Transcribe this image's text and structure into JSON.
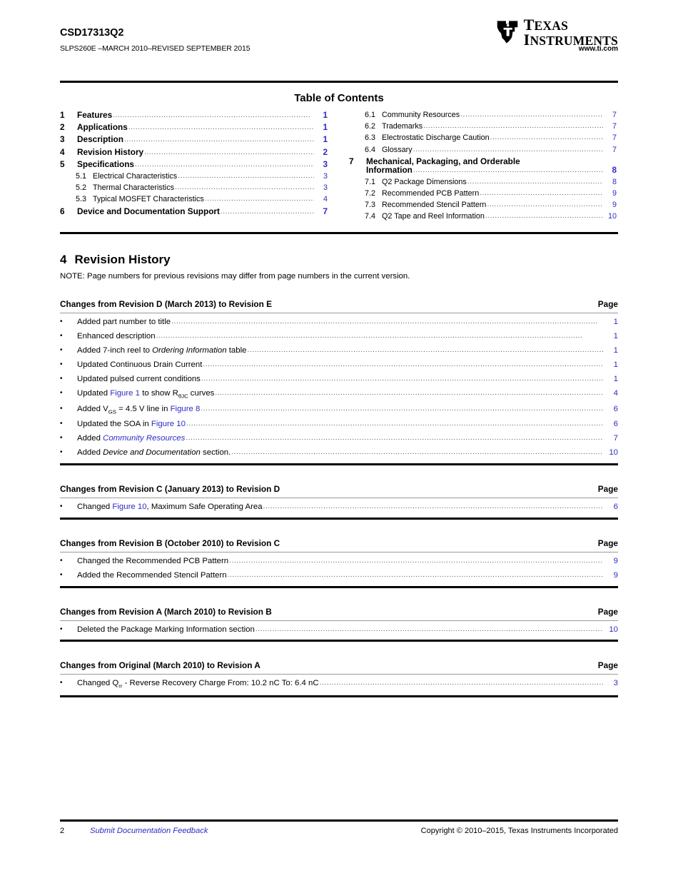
{
  "header": {
    "part_number": "CSD17313Q2",
    "doc_id": "SLPS260E –MARCH 2010–REVISED SEPTEMBER 2015",
    "url": "www.ti.com",
    "logo_line1": "EXAS",
    "logo_line1_cap": "T",
    "logo_line2": "NSTRUMENTS",
    "logo_line2_cap": "I",
    "logo_mark": "ti-texas-logo"
  },
  "toc": {
    "title": "Table of Contents",
    "left_column": [
      {
        "num": "1",
        "label": "Features",
        "page": "1",
        "level": 1
      },
      {
        "num": "2",
        "label": "Applications",
        "page": "1",
        "level": 1
      },
      {
        "num": "3",
        "label": "Description",
        "page": "1",
        "level": 1
      },
      {
        "num": "4",
        "label": "Revision History",
        "page": "2",
        "level": 1
      },
      {
        "num": "5",
        "label": "Specifications",
        "page": "3",
        "level": 1
      },
      {
        "num": "5.1",
        "label": "Electrical Characteristics",
        "page": "3",
        "level": 2
      },
      {
        "num": "5.2",
        "label": "Thermal Characteristics",
        "page": "3",
        "level": 2
      },
      {
        "num": "5.3",
        "label": "Typical MOSFET Characteristics",
        "page": "4",
        "level": 2
      },
      {
        "num": "6",
        "label": "Device and Documentation Support",
        "page": "7",
        "level": 1
      }
    ],
    "right_column": [
      {
        "num": "6.1",
        "label": "Community Resources",
        "page": "7",
        "level": 2
      },
      {
        "num": "6.2",
        "label": "Trademarks",
        "page": "7",
        "level": 2
      },
      {
        "num": "6.3",
        "label": "Electrostatic Discharge Caution",
        "page": "7",
        "level": 2
      },
      {
        "num": "6.4",
        "label": "Glossary",
        "page": "7",
        "level": 2
      },
      {
        "num": "7",
        "label": "Mechanical, Packaging, and Orderable",
        "label2": "Information",
        "page": "8",
        "level": 1,
        "wrap": true
      },
      {
        "num": "7.1",
        "label": "Q2 Package Dimensions",
        "page": "8",
        "level": 2
      },
      {
        "num": "7.2",
        "label": "Recommended PCB Pattern",
        "page": "9",
        "level": 2
      },
      {
        "num": "7.3",
        "label": "Recommended Stencil Pattern",
        "page": "9",
        "level": 2
      },
      {
        "num": "7.4",
        "label": "Q2 Tape and Reel Information",
        "page": "10",
        "level": 2
      }
    ]
  },
  "revision_history": {
    "section_num": "4",
    "section_title": "Revision History",
    "note": "NOTE: Page numbers for previous revisions may differ from page numbers in the current version.",
    "page_col_label": "Page",
    "bullet": "•",
    "blocks": [
      {
        "heading": "Changes from Revision D (March 2013) to Revision E",
        "page_label": "Page",
        "changes": [
          {
            "page": "1"
          },
          {
            "page": "1"
          },
          {
            "page": "1"
          },
          {
            "page": "1"
          },
          {
            "page": "1"
          },
          {
            "page": "4"
          },
          {
            "page": "6"
          },
          {
            "page": "6"
          },
          {
            "page": "7"
          },
          {
            "page": "10"
          }
        ]
      },
      {
        "heading": "Changes from Revision C (January 2013) to Revision D",
        "page_label": "Page",
        "changes": [
          {
            "page": "6"
          }
        ]
      },
      {
        "heading": "Changes from Revision B (October 2010) to Revision C",
        "page_label": "Page",
        "changes": [
          {
            "page": "9"
          },
          {
            "page": "9"
          }
        ]
      },
      {
        "heading": "Changes from Revision A (March 2010) to Revision B",
        "page_label": "Page",
        "changes": [
          {
            "page": "10"
          }
        ]
      },
      {
        "heading": "Changes from Original (March 2010) to Revision A",
        "page_label": "Page",
        "changes": [
          {
            "page": "3"
          }
        ]
      }
    ],
    "text": {
      "d_1": "Added part number to title",
      "d_2": "Enhanced description",
      "d_3a": "Added 7-inch reel to ",
      "d_3b": "Ordering Information",
      "d_3c": " table",
      "d_4": "Updated Continuous Drain Current",
      "d_5": "Updated pulsed current conditions",
      "d_6a": "Updated ",
      "d_6b": "Figure 1",
      "d_6c": " to show R",
      "d_6sub": "θJC",
      "d_6d": " curves",
      "d_7a": "Added V",
      "d_7sub": "GS",
      "d_7b": " = 4.5 V line in ",
      "d_7c": "Figure 8",
      "d_8a": "Updated the SOA in ",
      "d_8b": "Figure 10",
      "d_9a": "Added ",
      "d_9b": "Community Resources",
      "d_10a": "Added ",
      "d_10b": "Device and Documentation",
      "d_10c": " section.",
      "c_1a": "Changed ",
      "c_1b": "Figure 10",
      "c_1c": ", Maximum Safe Operating Area",
      "b_1": "Changed the Recommended PCB Pattern",
      "b_2": "Added the Recommended Stencil Pattern",
      "a_1": "Deleted the Package Marking Information section",
      "o_1a": "Changed Q",
      "o_1sub": "rr",
      "o_1b": " - Reverse Recovery Charge From: 10.2 nC To: 6.4 nC"
    }
  },
  "footer": {
    "page_number": "2",
    "feedback_link": "Submit Documentation Feedback",
    "copyright": "Copyright © 2010–2015, Texas Instruments Incorporated"
  },
  "colors": {
    "link": "#2c2cc4",
    "rule_dark": "#000000",
    "rule_grey": "#9a9a9a"
  }
}
